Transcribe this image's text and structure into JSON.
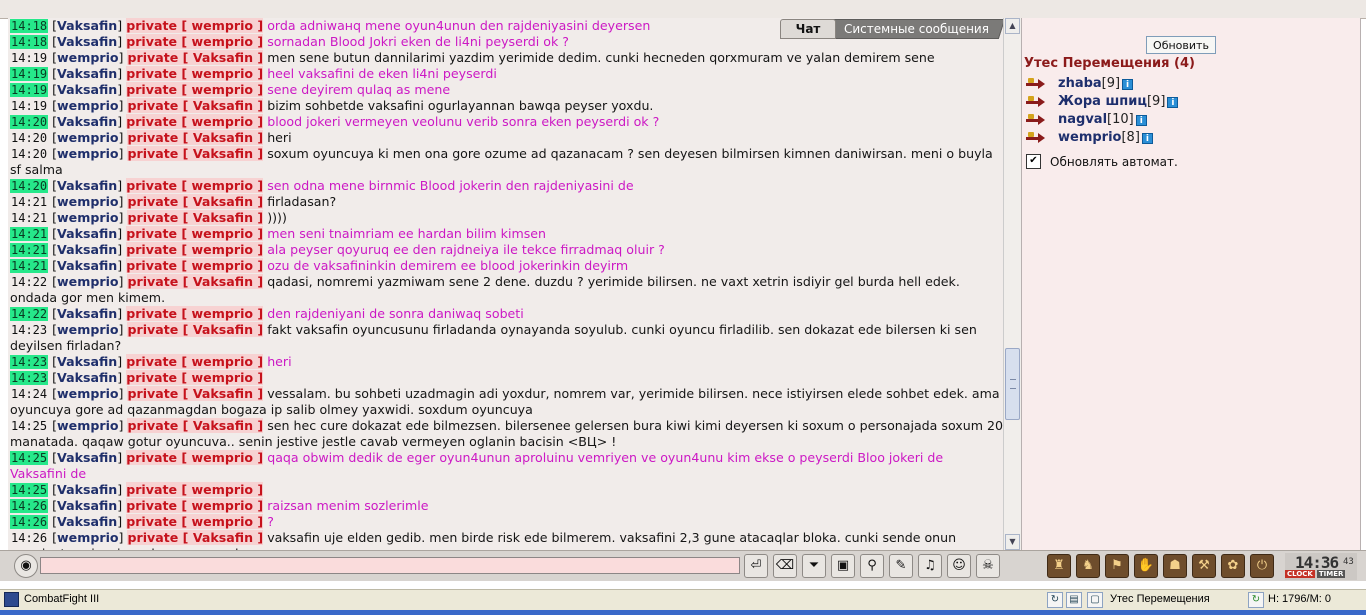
{
  "tabs": {
    "chat": "Чат",
    "system": "Системные сообщения"
  },
  "messages": [
    {
      "time": "14:18",
      "hl": true,
      "from": "Vaksafin",
      "to": "wemprio",
      "text": "orda adniwaнq mene oyun4unun den rajdeniyasini deyersen",
      "mine": true
    },
    {
      "time": "14:18",
      "hl": true,
      "from": "Vaksafin",
      "to": "wemprio",
      "text": "sornadan Blood Jokri eken de li4ni peyserdi ok ?",
      "mine": true
    },
    {
      "time": "14:19",
      "hl": false,
      "from": "wemprio",
      "to": "Vaksafin",
      "text": "men sene butun dannilarimi yazdim yerimide dedim. cunki hecneden qorxmuram ve yalan demirem sene",
      "mine": false
    },
    {
      "time": "14:19",
      "hl": true,
      "from": "Vaksafin",
      "to": "wemprio",
      "text": "heel vaksafini de eken li4ni peyserdi",
      "mine": true
    },
    {
      "time": "14:19",
      "hl": true,
      "from": "Vaksafin",
      "to": "wemprio",
      "text": "sene deyirem qulaq as mene",
      "mine": true
    },
    {
      "time": "14:19",
      "hl": false,
      "from": "wemprio",
      "to": "Vaksafin",
      "text": "bizim sohbetde vaksafini ogurlayannan bawqa peyser yoxdu.",
      "mine": false
    },
    {
      "time": "14:20",
      "hl": true,
      "from": "Vaksafin",
      "to": "wemprio",
      "text": "blood jokeri vermeyen veolunu verib sonra eken peyserdi ok ?",
      "mine": true
    },
    {
      "time": "14:20",
      "hl": false,
      "from": "wemprio",
      "to": "Vaksafin",
      "text": "heri",
      "mine": false
    },
    {
      "time": "14:20",
      "hl": false,
      "from": "wemprio",
      "to": "Vaksafin",
      "text": "soxum oyuncuya ki men ona gore ozume ad qazanacam ? sen deyesen bilmirsen kimnen daniwirsan. meni o buyla sf salma",
      "mine": false
    },
    {
      "time": "14:20",
      "hl": true,
      "from": "Vaksafin",
      "to": "wemprio",
      "text": "sen odna mene birnmic Blood jokerin den rajdeniyasini de",
      "mine": true
    },
    {
      "time": "14:21",
      "hl": false,
      "from": "wemprio",
      "to": "Vaksafin",
      "text": "firladasan?",
      "mine": false
    },
    {
      "time": "14:21",
      "hl": false,
      "from": "wemprio",
      "to": "Vaksafin",
      "text": "))))",
      "mine": false
    },
    {
      "time": "14:21",
      "hl": true,
      "from": "Vaksafin",
      "to": "wemprio",
      "text": "men seni tnaimriam ee hardan bilim kimsen",
      "mine": true
    },
    {
      "time": "14:21",
      "hl": true,
      "from": "Vaksafin",
      "to": "wemprio",
      "text": "ala peyser qoyuruq ee den rajdneiya ile tekce firradmaq oluir ?",
      "mine": true
    },
    {
      "time": "14:21",
      "hl": true,
      "from": "Vaksafin",
      "to": "wemprio",
      "text": "ozu de vaksafininkin demirem ee blood jokerinkin deyirm",
      "mine": true
    },
    {
      "time": "14:22",
      "hl": false,
      "from": "wemprio",
      "to": "Vaksafin",
      "text": "qadasi, nomremi yazmiwam sene 2 dene. duzdu ? yerimide bilirsen. ne vaxt xetrin isdiyir gel burda hell edek. ondada gor men kimem.",
      "mine": false
    },
    {
      "time": "14:22",
      "hl": true,
      "from": "Vaksafin",
      "to": "wemprio",
      "text": "den rajdeniyani de sonra daniwaq sobeti",
      "mine": true
    },
    {
      "time": "14:23",
      "hl": false,
      "from": "wemprio",
      "to": "Vaksafin",
      "text": "fakt vaksafin oyuncusunu firladanda oynayanda soyulub. cunki oyuncu firladilib. sen dokazat ede bilersen ki sen deyilsen firladan?",
      "mine": false
    },
    {
      "time": "14:23",
      "hl": true,
      "from": "Vaksafin",
      "to": "wemprio",
      "text": "heri",
      "mine": true
    },
    {
      "time": "14:23",
      "hl": true,
      "from": "Vaksafin",
      "to": "wemprio",
      "text": "",
      "mine": true
    },
    {
      "time": "14:24",
      "hl": false,
      "from": "wemprio",
      "to": "Vaksafin",
      "text": "vessalam. bu sohbeti uzadmagin adi yoxdur, nomrem var, yerimide bilirsen. nece istiyirsen elede sohbet edek. ama oyuncuya gore ad qazanmagdan bogaza ip salib olmey yaxwidi. soxdum oyuncuya",
      "mine": false
    },
    {
      "time": "14:25",
      "hl": false,
      "from": "wemprio",
      "to": "Vaksafin",
      "text": "sen hec cure dokazat ede bilmezsen. bilersenee gelersen bura kiwi kimi deyersen ki soxum o personajada soxum 20 manatada. qaqaw gotur oyuncuva.. senin jestive jestle cavab vermeyen oglanin bacisin <ВЦ> !",
      "mine": false
    },
    {
      "time": "14:25",
      "hl": true,
      "from": "Vaksafin",
      "to": "wemprio",
      "text": "qaqa obwim dedik de eger oyun4unun aproluinu vemriyen ve oyun4unu kim ekse o peyserdi Bloo jokeri de Vaksafini de",
      "mine": true
    },
    {
      "time": "14:25",
      "hl": true,
      "from": "Vaksafin",
      "to": "wemprio",
      "text": "",
      "mine": true
    },
    {
      "time": "14:26",
      "hl": true,
      "from": "Vaksafin",
      "to": "wemprio",
      "text": "raizsan menim sozlerimle",
      "mine": true
    },
    {
      "time": "14:26",
      "hl": true,
      "from": "Vaksafin",
      "to": "wemprio",
      "text": "?",
      "mine": true
    },
    {
      "time": "14:26",
      "hl": false,
      "from": "wemprio",
      "to": "Vaksafin",
      "text": "vaksafin uje elden gedib. men birde risk ede bilmerem. vaksafini 2,3 gune atacaqlar bloka. cunki sende onun wexsiyet vesiqesi yoxdu. ama mende var",
      "mine": false
    }
  ],
  "right_panel": {
    "refresh_label": "Обновить",
    "room_title": "Утес Перемещения (4)",
    "users": [
      {
        "name": "zhaba",
        "level": "[9]"
      },
      {
        "name": "Жора шпиц",
        "level": "[9]"
      },
      {
        "name": "nagval",
        "level": "[10]"
      },
      {
        "name": "wemprio",
        "level": "[8]"
      }
    ],
    "info_glyph": "i",
    "autoupdate_label": "Обновлять автомат.",
    "autoupdate_checked": "✔"
  },
  "toolbar": {
    "input_value": "",
    "buttons": [
      "⏎",
      "⌫",
      "⏷",
      "▣",
      "⚲",
      "✎",
      "♫",
      "☺",
      "☠"
    ],
    "right_buttons": [
      "♜",
      "♞",
      "⚑",
      "✋",
      "☗",
      "⚒",
      "✿",
      "⏻"
    ],
    "clock": {
      "time": "14:36",
      "seconds": "43",
      "label_clock": "CLOCK",
      "label_timer": "TIMER"
    }
  },
  "statusbar": {
    "app_name": "CombatFight III",
    "location": "Утес Перемещения",
    "hp": "H: 1796/M: 0"
  },
  "private_label": "private",
  "colors": {
    "highlight_time": "#26e88a",
    "private": "#c6121c",
    "mine_text": "#cc19c4",
    "nick": "#1f2f6b"
  }
}
